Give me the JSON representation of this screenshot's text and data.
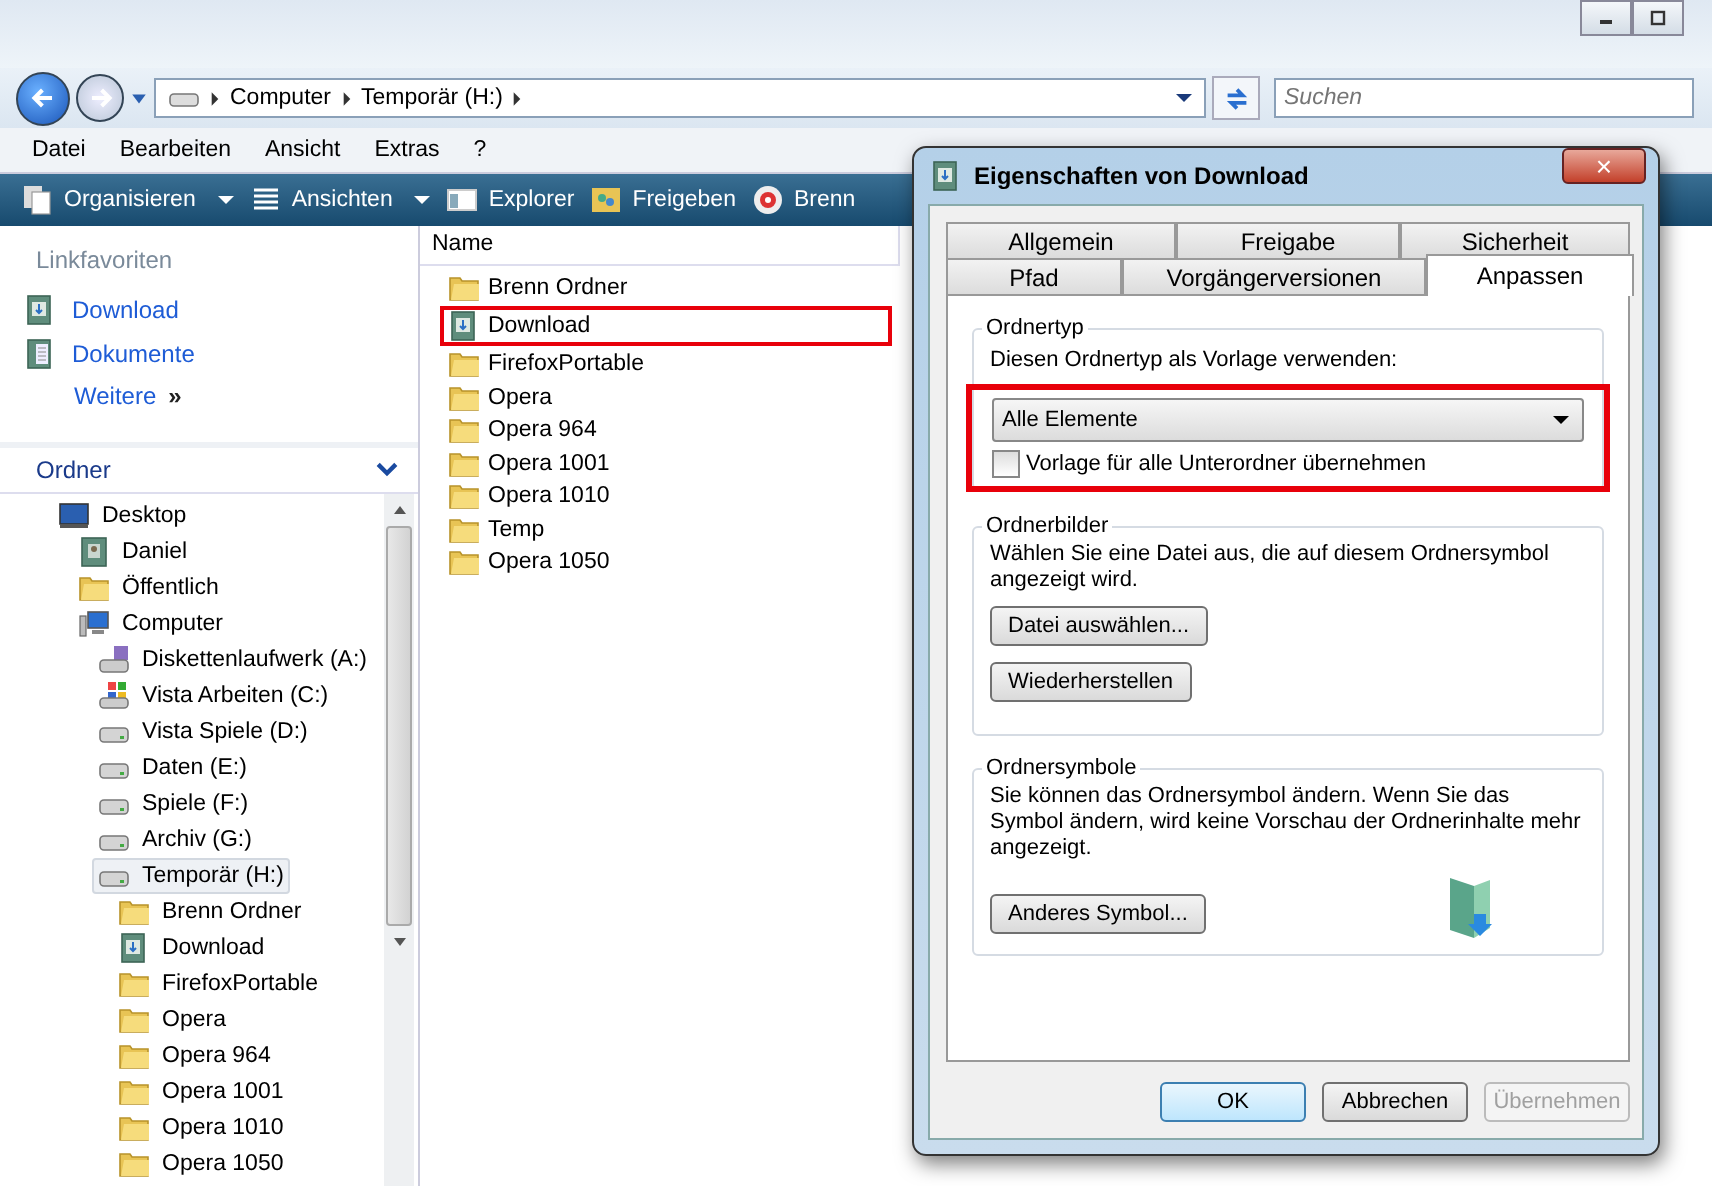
{
  "address_bar": {
    "segments": [
      "Computer",
      "Temporär (H:)"
    ]
  },
  "search": {
    "placeholder": "Suchen"
  },
  "menu": [
    "Datei",
    "Bearbeiten",
    "Ansicht",
    "Extras",
    "?"
  ],
  "toolbar": [
    {
      "label": "Organisieren",
      "kind": "organize",
      "dropdown": true
    },
    {
      "label": "Ansichten",
      "kind": "views",
      "dropdown": true
    },
    {
      "label": "Explorer",
      "kind": "explorer",
      "dropdown": false
    },
    {
      "label": "Freigeben",
      "kind": "share",
      "dropdown": false
    },
    {
      "label": "Brenn",
      "kind": "burn",
      "dropdown": false
    }
  ],
  "favorites": {
    "title": "Linkfavoriten",
    "items": [
      {
        "label": "Download",
        "kind": "download"
      },
      {
        "label": "Dokumente",
        "kind": "documents"
      }
    ],
    "more": "Weitere",
    "more_arrow": "»"
  },
  "folders": {
    "title": "Ordner",
    "tree": [
      {
        "label": "Desktop",
        "kind": "desktop",
        "selected": false,
        "children": [
          {
            "label": "Daniel",
            "kind": "user",
            "selected": false
          },
          {
            "label": "Öffentlich",
            "kind": "folder",
            "selected": false
          },
          {
            "label": "Computer",
            "kind": "computer",
            "selected": false,
            "children": [
              {
                "label": "Diskettenlaufwerk (A:)",
                "kind": "floppy",
                "selected": false
              },
              {
                "label": "Vista Arbeiten (C:)",
                "kind": "windrive",
                "selected": false
              },
              {
                "label": "Vista Spiele (D:)",
                "kind": "drive",
                "selected": false
              },
              {
                "label": "Daten (E:)",
                "kind": "drive",
                "selected": false
              },
              {
                "label": "Spiele (F:)",
                "kind": "drive",
                "selected": false
              },
              {
                "label": "Archiv (G:)",
                "kind": "drive",
                "selected": false
              },
              {
                "label": "Temporär (H:)",
                "kind": "drive",
                "selected": true,
                "children": [
                  {
                    "label": "Brenn Ordner",
                    "kind": "folder",
                    "selected": false
                  },
                  {
                    "label": "Download",
                    "kind": "download",
                    "selected": false
                  },
                  {
                    "label": "FirefoxPortable",
                    "kind": "folder",
                    "selected": false
                  },
                  {
                    "label": "Opera",
                    "kind": "folder",
                    "selected": false
                  },
                  {
                    "label": "Opera 964",
                    "kind": "folder",
                    "selected": false
                  },
                  {
                    "label": "Opera 1001",
                    "kind": "folder",
                    "selected": false
                  },
                  {
                    "label": "Opera 1010",
                    "kind": "folder",
                    "selected": false
                  },
                  {
                    "label": "Opera 1050",
                    "kind": "folder",
                    "selected": false
                  }
                ]
              }
            ]
          }
        ]
      }
    ]
  },
  "file_list": {
    "column": "Name",
    "items": [
      {
        "name": "Brenn Ordner",
        "kind": "folder",
        "highlighted": false
      },
      {
        "name": "Download",
        "kind": "download",
        "highlighted": true
      },
      {
        "name": "FirefoxPortable",
        "kind": "folder",
        "highlighted": false
      },
      {
        "name": "Opera",
        "kind": "folder",
        "highlighted": false
      },
      {
        "name": "Opera 964",
        "kind": "folder",
        "highlighted": false
      },
      {
        "name": "Opera 1001",
        "kind": "folder",
        "highlighted": false
      },
      {
        "name": "Opera 1010",
        "kind": "folder",
        "highlighted": false
      },
      {
        "name": "Temp",
        "kind": "folder",
        "highlighted": false
      },
      {
        "name": "Opera 1050",
        "kind": "folder",
        "highlighted": false
      }
    ]
  },
  "dialog": {
    "title": "Eigenschaften von Download",
    "close": "×",
    "tab_rows": [
      [
        {
          "label": "Allgemein",
          "selected": false
        },
        {
          "label": "Freigabe",
          "selected": false
        },
        {
          "label": "Sicherheit",
          "selected": false
        }
      ],
      [
        {
          "label": "Pfad",
          "selected": false
        },
        {
          "label": "Vorgängerversionen",
          "selected": false
        },
        {
          "label": "Anpassen",
          "selected": true
        }
      ]
    ],
    "folder_type": {
      "title": "Ordnertyp",
      "label": "Diesen Ordnertyp als Vorlage verwenden:",
      "value": "Alle Elemente",
      "checkbox": {
        "label": "Vorlage für alle Unterordner übernehmen",
        "checked": false
      },
      "highlighted": true
    },
    "folder_pictures": {
      "title": "Ordnerbilder",
      "text": "Wählen Sie eine Datei aus, die auf diesem Ordnersymbol angezeigt wird.",
      "buttons": [
        "Datei auswählen...",
        "Wiederherstellen"
      ]
    },
    "folder_icons": {
      "title": "Ordnersymbole",
      "text": "Sie können das Ordnersymbol ändern. Wenn Sie das Symbol ändern, wird keine Vorschau der Ordnerinhalte mehr angezeigt.",
      "button": "Anderes Symbol..."
    },
    "buttons": [
      {
        "label": "OK",
        "kind": "default",
        "disabled": false
      },
      {
        "label": "Abbrechen",
        "kind": "normal",
        "disabled": false
      },
      {
        "label": "Übernehmen",
        "kind": "normal",
        "disabled": true
      }
    ]
  }
}
